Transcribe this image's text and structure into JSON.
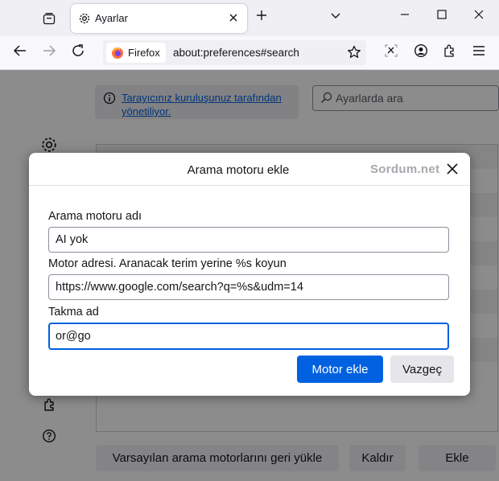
{
  "tabstrip": {
    "tab_title": "Ayarlar"
  },
  "navbar": {
    "identity_label": "Firefox",
    "url": "about:preferences#search"
  },
  "content": {
    "policy_notice": "Tarayıcınız kuruluşunuz tarafından yönetiliyor.",
    "search_placeholder": "Ayarlarda ara",
    "restore_button": "Varsayılan arama motorlarını geri yükle",
    "remove_button": "Kaldır",
    "add_button": "Ekle"
  },
  "dialog": {
    "title": "Arama motoru ekle",
    "watermark": "Sordum.net",
    "name_label": "Arama motoru adı",
    "name_value": "AI yok",
    "url_label": "Motor adresi. Aranacak terim yerine %s koyun",
    "url_value": "https://www.google.com/search?q=%s&udm=14",
    "alias_label": "Takma ad",
    "alias_value": "or@go",
    "add_button": "Motor ekle",
    "cancel_button": "Vazgeç"
  },
  "colors": {
    "accent": "#0061e0",
    "firefox_orange": "#ff7139"
  }
}
